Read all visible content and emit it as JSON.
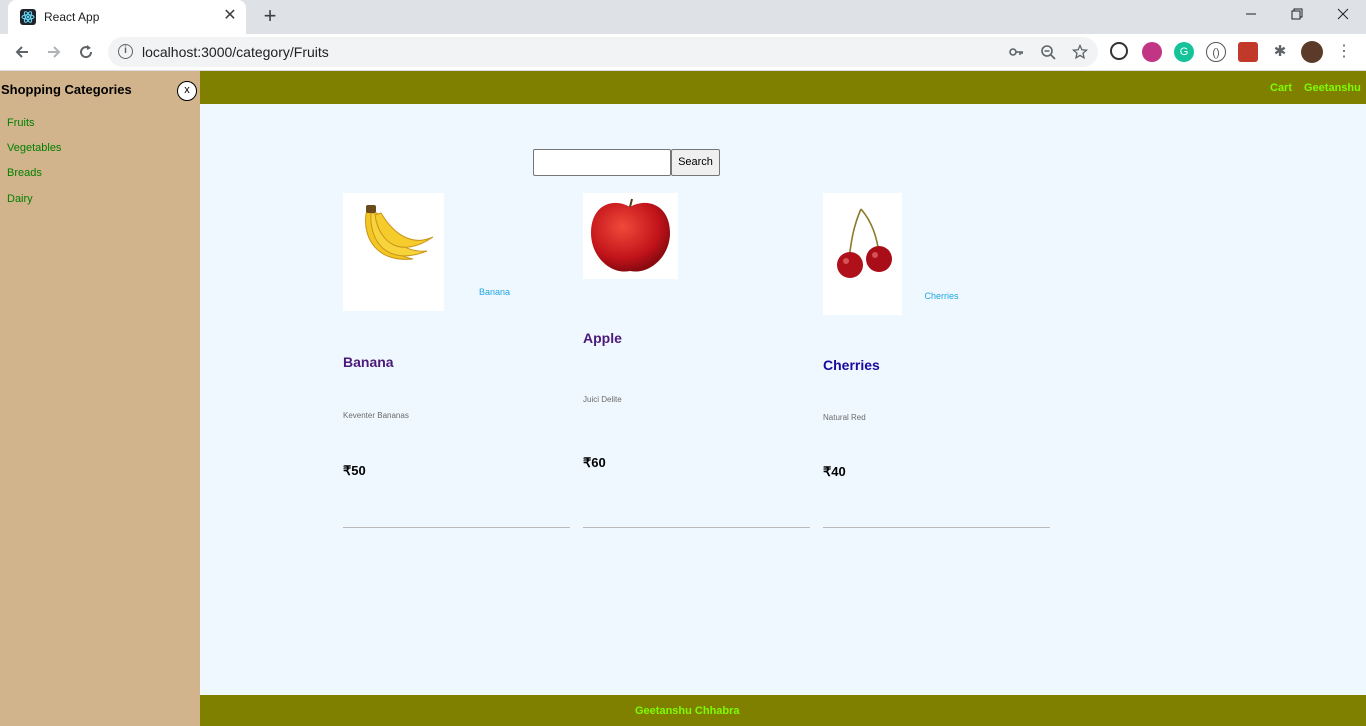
{
  "browser": {
    "tab_title": "React App",
    "url": "localhost:3000/category/Fruits",
    "tab_close_glyph": "✕",
    "new_tab_glyph": "+"
  },
  "sidebar": {
    "title": "Shopping Categories",
    "close_label": "x",
    "items": [
      {
        "label": "Fruits"
      },
      {
        "label": "Vegetables"
      },
      {
        "label": "Breads"
      },
      {
        "label": "Dairy"
      }
    ]
  },
  "topnav": {
    "cart_label": "Cart",
    "user_label": "Geetanshu"
  },
  "search": {
    "button_label": "Search",
    "value": ""
  },
  "products": [
    {
      "name": "Banana",
      "brand": "Keventer Bananas",
      "price": "₹50",
      "image_caption": "Banana",
      "name_color": "#4b1a7a"
    },
    {
      "name": "Apple",
      "brand": "Juici Delite",
      "price": "₹60",
      "image_caption": "",
      "name_color": "#4b1a7a"
    },
    {
      "name": "Cherries",
      "brand": "Natural Red",
      "price": "₹40",
      "image_caption": "Cherries",
      "name_color": "#1a0a9e"
    }
  ],
  "footer": {
    "text": "Geetanshu Chhabra"
  },
  "colors": {
    "sidebar_bg": "#d2b48c",
    "nav_bg": "#808000",
    "nav_text": "#7cfc00",
    "page_bg": "#f0f8ff",
    "link_green": "#008000"
  }
}
